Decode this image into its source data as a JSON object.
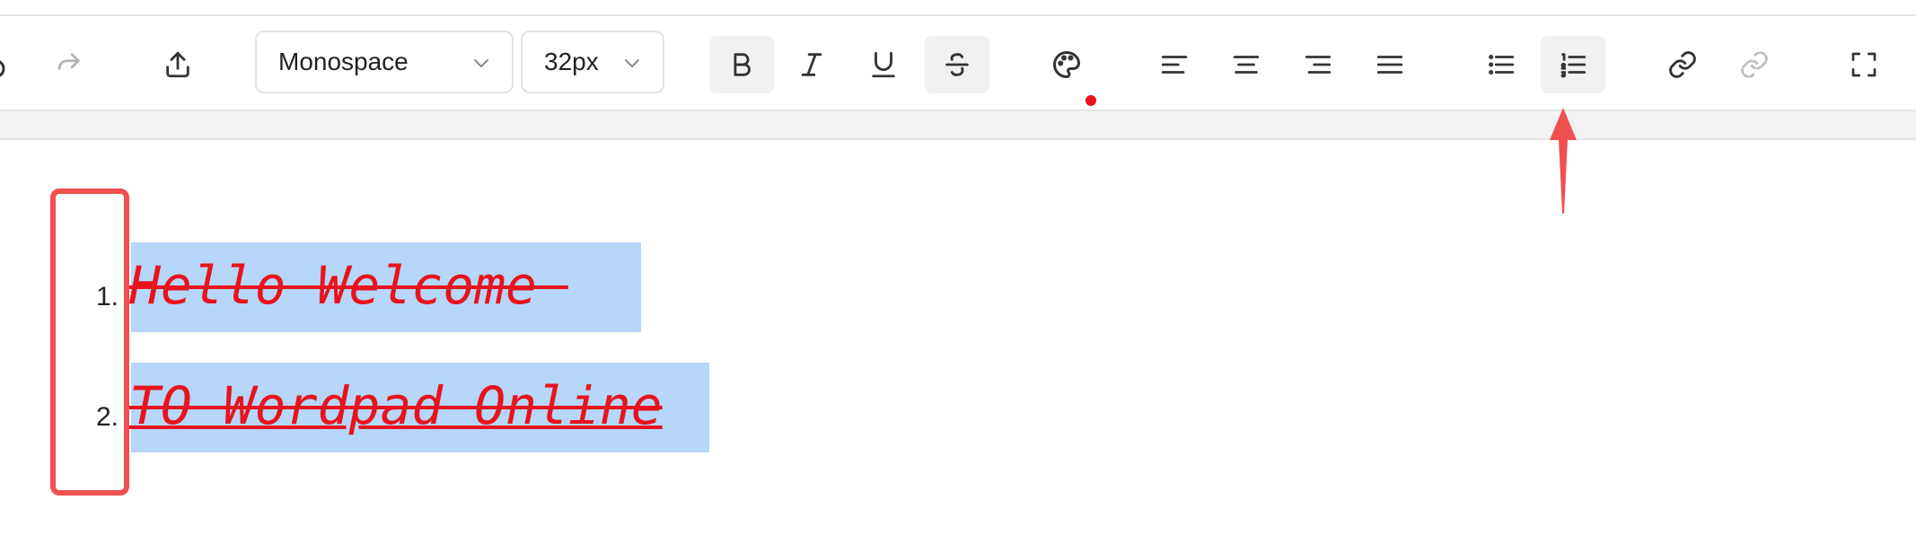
{
  "toolbar": {
    "font_family": "Monospace",
    "font_size": "32px",
    "text_color": "#e8131c",
    "buttons": {
      "undo": "undo-icon",
      "redo": "redo-icon",
      "export": "upload-icon",
      "bold": "B",
      "italic": "I",
      "underline": "U",
      "strike": "S",
      "palette": "palette-icon",
      "align_left": "align-left-icon",
      "align_center": "align-center-icon",
      "align_right": "align-right-icon",
      "align_justify": "align-justify-icon",
      "bullet_list": "bullet-list-icon",
      "ordered_list": "ordered-list-icon",
      "link": "link-icon",
      "unlink": "unlink-icon",
      "fullscreen": "fullscreen-icon"
    }
  },
  "document": {
    "list": [
      {
        "number": "1.",
        "text": "Hello Welcome "
      },
      {
        "number": "2.",
        "text": "TO Wordpad Online"
      }
    ]
  },
  "colors": {
    "accent_red": "#f0504f",
    "selection": "#b6d6fa",
    "text_red": "#e8131c"
  }
}
